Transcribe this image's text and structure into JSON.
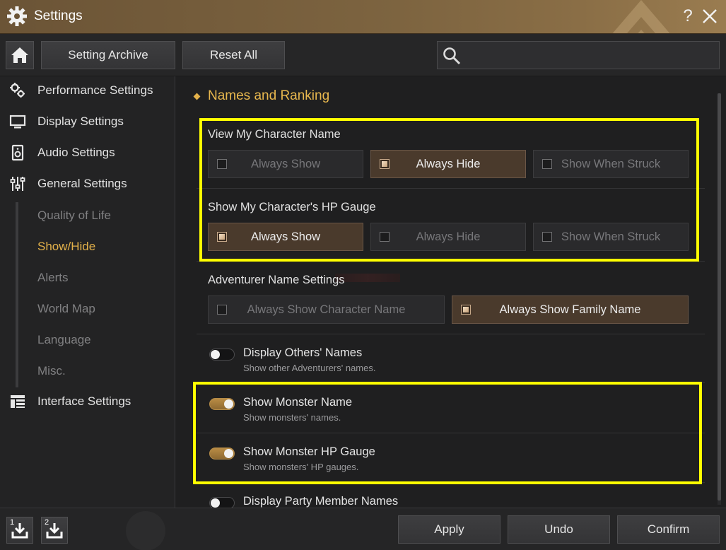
{
  "window": {
    "title": "Settings",
    "help_glyph": "?"
  },
  "toolbar": {
    "setting_archive": "Setting Archive",
    "reset_all": "Reset All",
    "search_placeholder": ""
  },
  "sidebar": {
    "items": [
      {
        "label": "Performance Settings",
        "icon": "gears-icon"
      },
      {
        "label": "Display Settings",
        "icon": "monitor-icon"
      },
      {
        "label": "Audio Settings",
        "icon": "speaker-icon"
      },
      {
        "label": "General Settings",
        "icon": "sliders-icon"
      },
      {
        "label": "Interface Settings",
        "icon": "layout-icon"
      }
    ],
    "sub_items": [
      {
        "label": "Quality of Life",
        "active": false
      },
      {
        "label": "Show/Hide",
        "active": true
      },
      {
        "label": "Alerts",
        "active": false
      },
      {
        "label": "World Map",
        "active": false
      },
      {
        "label": "Language",
        "active": false
      },
      {
        "label": "Misc.",
        "active": false
      }
    ]
  },
  "main": {
    "section_title": "Names and Ranking",
    "view_name": {
      "label": "View My Character Name",
      "options": [
        "Always Show",
        "Always Hide",
        "Show When Struck"
      ],
      "selected": "Always Hide"
    },
    "hp_gauge": {
      "label": "Show My Character's HP Gauge",
      "options": [
        "Always Show",
        "Always Hide",
        "Show When Struck"
      ],
      "selected": "Always Show"
    },
    "adventurer_name": {
      "label": "Adventurer Name Settings",
      "options": [
        "Always Show Character Name",
        "Always Show Family Name"
      ],
      "selected": "Always Show Family Name"
    },
    "toggles": [
      {
        "label": "Display Others' Names",
        "desc": "Show other Adventurers' names.",
        "on": false
      },
      {
        "label": "Show Monster Name",
        "desc": "Show monsters' names.",
        "on": true
      },
      {
        "label": "Show Monster HP Gauge",
        "desc": "Show monsters' HP gauges.",
        "on": true
      },
      {
        "label": "Display Party Member Names",
        "desc": "",
        "on": false
      }
    ]
  },
  "bottom": {
    "slot1": "1",
    "slot2": "2",
    "apply": "Apply",
    "undo": "Undo",
    "confirm": "Confirm"
  },
  "colors": {
    "accent_gold": "#e3b14a",
    "highlight_yellow": "#ffff00",
    "selected_option_bg": "#4a3a2c"
  }
}
